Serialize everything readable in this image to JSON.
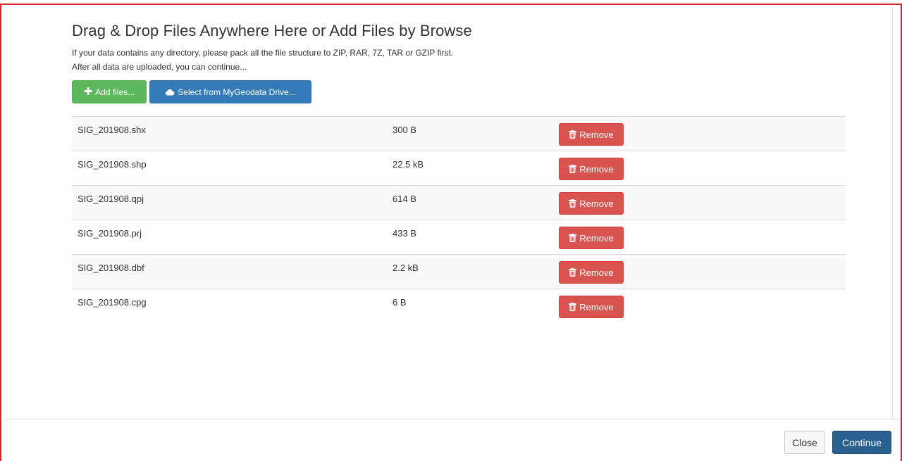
{
  "dialog": {
    "title": "Drag & Drop Files Anywhere Here or Add Files by Browse",
    "description_line1": "If your data contains any directory, please pack all the file structure to ZIP, RAR, 7Z, TAR or GZIP first.",
    "description_line2": "After all data are uploaded, you can continue..."
  },
  "actions": {
    "add_files_label": "Add files...",
    "select_drive_label": "Select from MyGeodata Drive..."
  },
  "files": [
    {
      "name": "SIG_201908.shx",
      "size": "300 B",
      "remove_label": "Remove"
    },
    {
      "name": "SIG_201908.shp",
      "size": "22.5 kB",
      "remove_label": "Remove"
    },
    {
      "name": "SIG_201908.qpj",
      "size": "614 B",
      "remove_label": "Remove"
    },
    {
      "name": "SIG_201908.prj",
      "size": "433 B",
      "remove_label": "Remove"
    },
    {
      "name": "SIG_201908.dbf",
      "size": "2.2 kB",
      "remove_label": "Remove"
    },
    {
      "name": "SIG_201908.cpg",
      "size": "6 B",
      "remove_label": "Remove"
    }
  ],
  "footer": {
    "close_label": "Close",
    "continue_label": "Continue"
  },
  "icons": {
    "add": "plus-icon",
    "drive": "cloud-icon",
    "remove": "trash-icon"
  },
  "colors": {
    "success": "#5cb85c",
    "primary": "#337ab7",
    "danger": "#d9534f",
    "frame_border": "#d9252f"
  }
}
